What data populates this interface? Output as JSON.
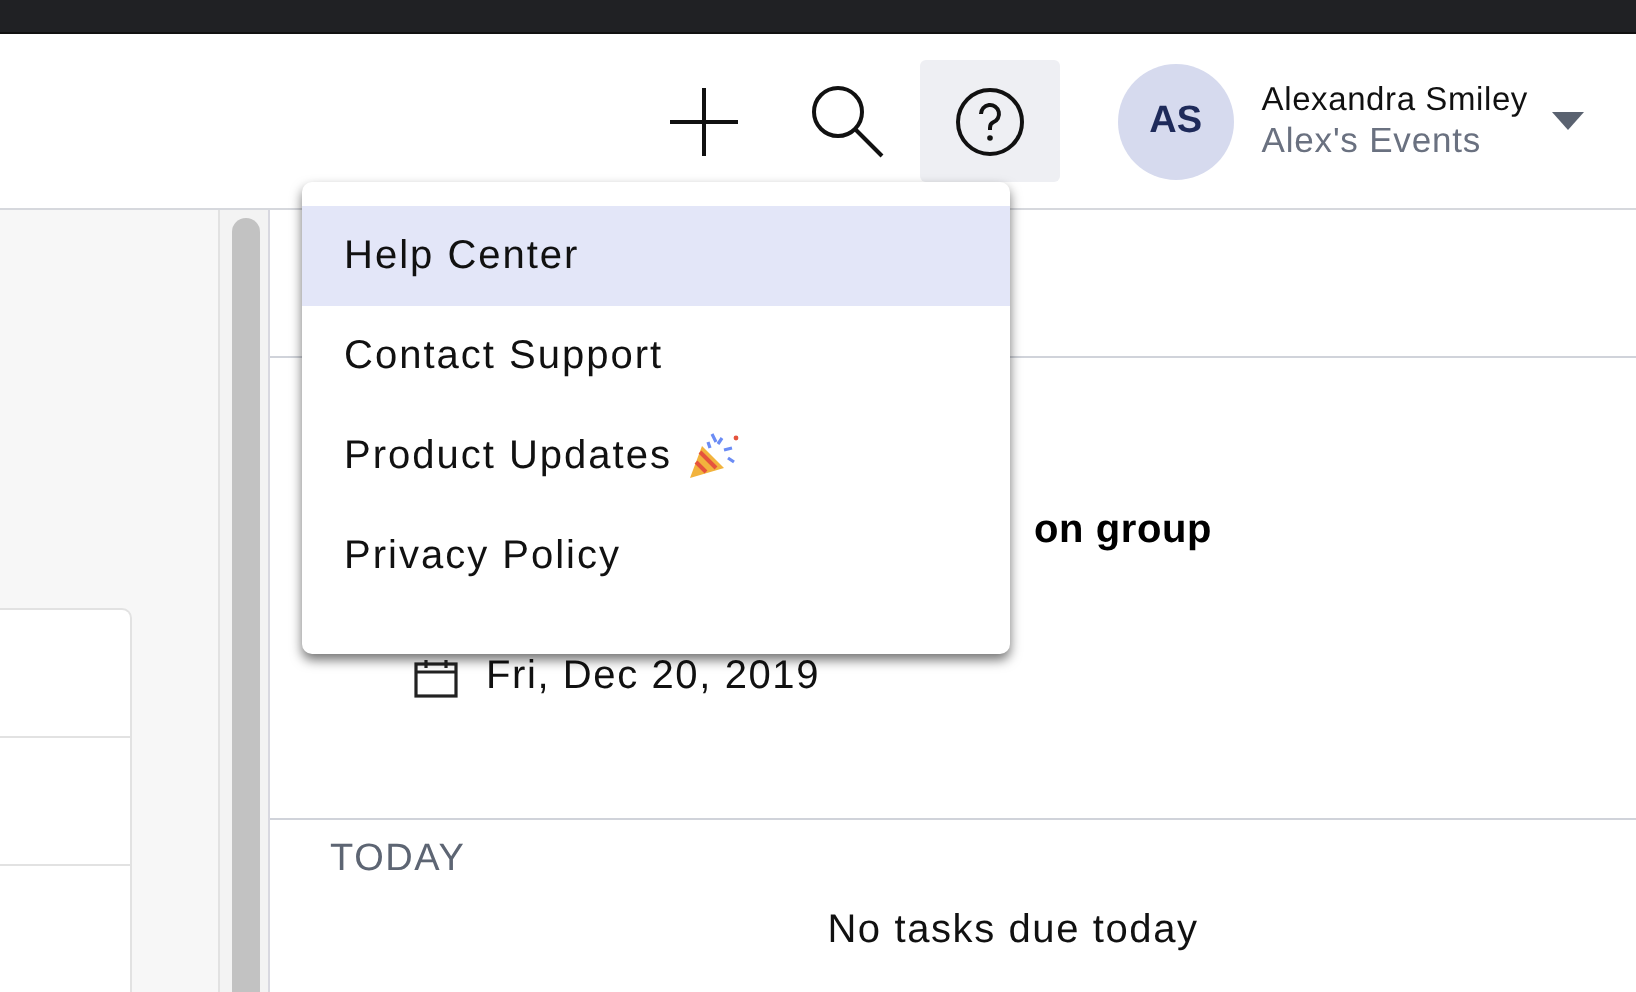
{
  "header": {
    "help_button": {
      "expanded": true
    },
    "profile": {
      "initials": "AS",
      "name": "Alexandra Smiley",
      "subtitle": "Alex's Events"
    }
  },
  "help_menu": {
    "items": [
      {
        "label": "Help Center",
        "kind": "plain",
        "selected": true
      },
      {
        "label": "Contact Support",
        "kind": "plain",
        "selected": false
      },
      {
        "label": "Product Updates",
        "kind": "party",
        "selected": false
      },
      {
        "label": "Privacy Policy",
        "kind": "plain",
        "selected": false
      }
    ]
  },
  "task": {
    "title": "on group",
    "due_date": "Fri, Dec 20, 2019"
  },
  "today": {
    "heading": "TODAY",
    "empty_message": "No tasks due today"
  }
}
